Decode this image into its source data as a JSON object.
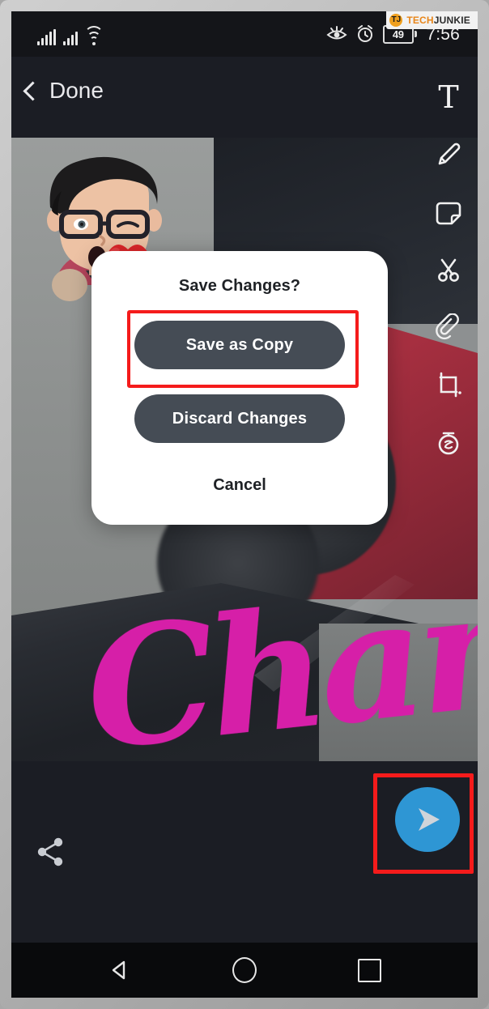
{
  "statusbar": {
    "signal_icon_1": "cellular-signal-icon",
    "signal_icon_2": "cellular-signal-icon",
    "wifi_icon": "wifi-icon",
    "eye_icon": "eye-care-icon",
    "alarm_icon": "alarm-clock-icon",
    "battery_level": "49",
    "battery_icon": "battery-icon",
    "time": "7:56"
  },
  "watermark": {
    "badge": "TJ",
    "tech": "TECH",
    "junkie": "JUNKIE"
  },
  "header": {
    "back_icon": "chevron-left-icon",
    "done_label": "Done"
  },
  "toolbar": {
    "items": [
      {
        "name": "text-tool",
        "label": "T",
        "icon": "text-icon"
      },
      {
        "name": "draw-tool",
        "icon": "pencil-icon"
      },
      {
        "name": "sticker-tool",
        "icon": "sticker-icon"
      },
      {
        "name": "cut-tool",
        "icon": "scissors-icon"
      },
      {
        "name": "attach-tool",
        "icon": "paperclip-icon"
      },
      {
        "name": "crop-tool",
        "icon": "crop-icon"
      },
      {
        "name": "timer-tool",
        "icon": "stopwatch-icon"
      }
    ]
  },
  "canvas": {
    "sticker": "bitmoji-kiss-sticker",
    "script_text": "Chanel",
    "script_color": "#d61fa8"
  },
  "dialog": {
    "title": "Save Changes?",
    "save_label": "Save as Copy",
    "discard_label": "Discard Changes",
    "cancel_label": "Cancel",
    "button_color": "#454c55",
    "highlight_color": "#f51b1b"
  },
  "bottombar": {
    "share_icon": "share-icon",
    "send_icon": "send-arrow-icon",
    "send_color": "#2e96d4"
  },
  "navbar": {
    "back_icon": "triangle-back-icon",
    "home_icon": "circle-home-icon",
    "recents_icon": "square-recents-icon"
  }
}
